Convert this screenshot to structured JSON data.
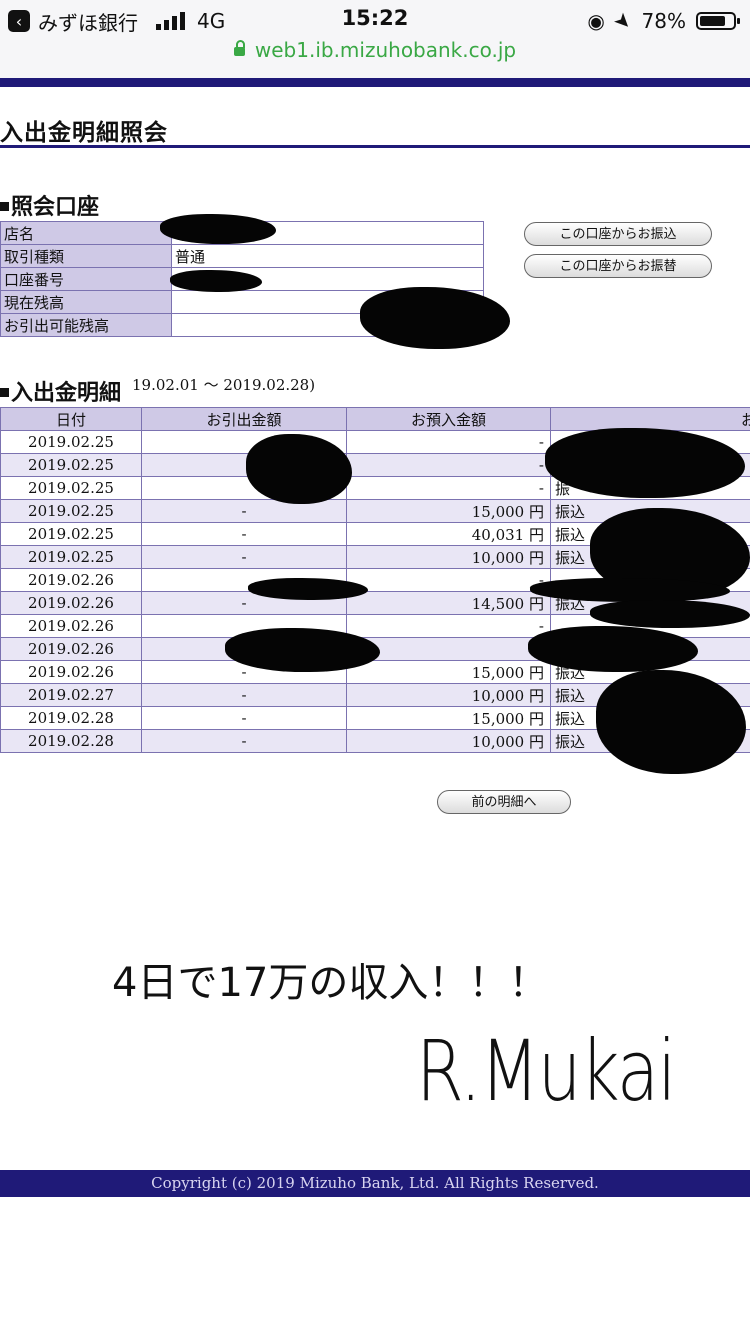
{
  "status_bar": {
    "back_app": "みずほ銀行",
    "network": "4G",
    "time": "15:22",
    "battery": "78%",
    "battery_level": 0.78
  },
  "url": "web1.ib.mizuhobank.co.jp",
  "page_title": "入出金明細照会",
  "account_section": {
    "heading": "照会口座",
    "rows": [
      {
        "label": "店名",
        "value": ""
      },
      {
        "label": "取引種類",
        "value": "普通"
      },
      {
        "label": "口座番号",
        "value": ""
      },
      {
        "label": "現在残高",
        "value": ""
      },
      {
        "label": "お引出可能残高",
        "value": ""
      }
    ],
    "buttons": {
      "transfer": "この口座からお振込",
      "move": "この口座からお振替"
    }
  },
  "transactions_section": {
    "heading": "入出金明細",
    "period": "19.02.01 ～ 2019.02.28)",
    "columns": [
      "日付",
      "お引出金額",
      "お預入金額",
      "お"
    ],
    "rows": [
      {
        "date": "2019.02.25",
        "withdrawal": "",
        "deposit": "-",
        "desc": ""
      },
      {
        "date": "2019.02.25",
        "withdrawal": "",
        "deposit": "-",
        "desc": ""
      },
      {
        "date": "2019.02.25",
        "withdrawal": "",
        "deposit": "-",
        "desc": "振"
      },
      {
        "date": "2019.02.25",
        "withdrawal": "-",
        "deposit": "15,000 円",
        "desc": "振込"
      },
      {
        "date": "2019.02.25",
        "withdrawal": "-",
        "deposit": "40,031 円",
        "desc": "振込"
      },
      {
        "date": "2019.02.25",
        "withdrawal": "-",
        "deposit": "10,000 円",
        "desc": "振込"
      },
      {
        "date": "2019.02.26",
        "withdrawal": "",
        "deposit": "-",
        "desc": ""
      },
      {
        "date": "2019.02.26",
        "withdrawal": "-",
        "deposit": "14,500 円",
        "desc": "振込"
      },
      {
        "date": "2019.02.26",
        "withdrawal": "",
        "deposit": "-",
        "desc": ""
      },
      {
        "date": "2019.02.26",
        "withdrawal": "",
        "deposit": "-",
        "desc": ""
      },
      {
        "date": "2019.02.26",
        "withdrawal": "-",
        "deposit": "15,000 円",
        "desc": "振込"
      },
      {
        "date": "2019.02.27",
        "withdrawal": "-",
        "deposit": "10,000 円",
        "desc": "振込"
      },
      {
        "date": "2019.02.28",
        "withdrawal": "-",
        "deposit": "15,000 円",
        "desc": "振込"
      },
      {
        "date": "2019.02.28",
        "withdrawal": "-",
        "deposit": "10,000 円",
        "desc": "振込"
      }
    ],
    "prev_button": "前の明細へ"
  },
  "caption": "4日で17万の収入！！！",
  "signature": "R.Mukai",
  "footer": "Copyright (c) 2019 Mizuho Bank, Ltd. All Rights Reserved."
}
